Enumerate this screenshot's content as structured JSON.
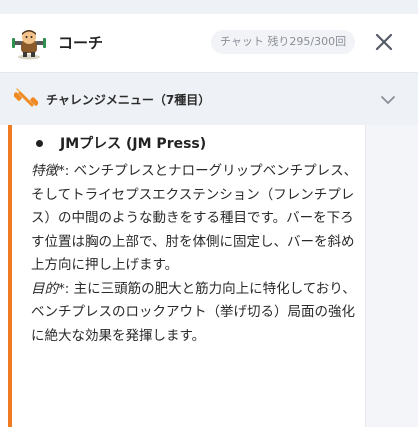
{
  "header": {
    "title": "コーチ",
    "remaining": "チャット 残り295/300回"
  },
  "menu": {
    "title": "チャレンジメニュー（7種目）"
  },
  "exercise": {
    "name": "JMプレス (JM Press)",
    "feature_label": "特徴",
    "feature_suffix": "*: ",
    "feature_text": "ベンチプレスとナローグリップベンチプレス、そしてトライセプスエクステンション（フレンチプレス）の中間のような動きをする種目です。バーを下ろす位置は胸の上部で、肘を体側に固定し、バーを斜め上方向に押し上げます。",
    "purpose_label": "目的",
    "purpose_suffix": "*: ",
    "purpose_text": "主に三頭筋の肥大と筋力向上に特化しており、ベンチプレスのロックアウト（挙げ切る）局面の強化に絶大な効果を発揮します。"
  },
  "colors": {
    "accent": "#f07a22",
    "menu_background": "#eef1f5",
    "badge_background": "#f1f3f6"
  },
  "icons": {
    "avatar": "coach-mascot-avatar",
    "close": "close-icon",
    "menu": "dumbbell-icon",
    "chevron": "chevron-down-icon"
  }
}
